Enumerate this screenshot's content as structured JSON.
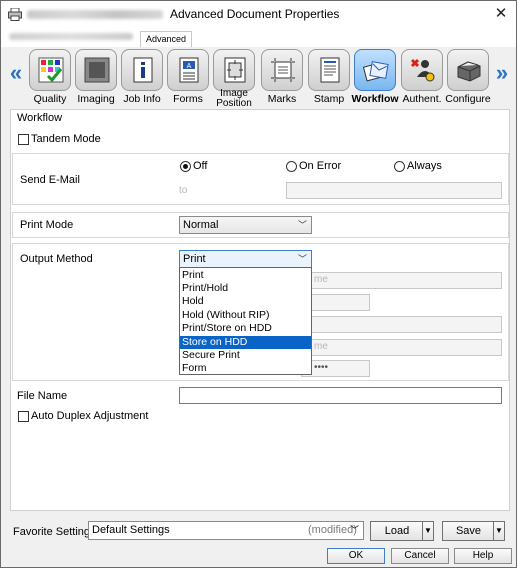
{
  "window": {
    "title": "Advanced Document Properties"
  },
  "tabs": {
    "advanced": "Advanced"
  },
  "iconbar": {
    "items": [
      {
        "label": "Quality",
        "icon": "quality-icon"
      },
      {
        "label": "Imaging",
        "icon": "imaging-icon"
      },
      {
        "label": "Job Info",
        "icon": "job-info-icon"
      },
      {
        "label": "Forms",
        "icon": "forms-icon"
      },
      {
        "label": "Image Position",
        "icon": "image-position-icon"
      },
      {
        "label": "Marks",
        "icon": "marks-icon"
      },
      {
        "label": "Stamp",
        "icon": "stamp-icon"
      },
      {
        "label": "Workflow",
        "icon": "workflow-icon",
        "active": true
      },
      {
        "label": "Authent.",
        "icon": "authent-icon"
      },
      {
        "label": "Configure",
        "icon": "configure-icon"
      }
    ],
    "left_arrow": "«",
    "right_arrow": "»"
  },
  "workflow": {
    "section_label": "Workflow",
    "tandem_mode": "Tandem Mode",
    "send_email": {
      "label": "Send E-Mail",
      "options": [
        "Off",
        "On Error",
        "Always"
      ],
      "selected": "Off",
      "to_label": "to",
      "to_value": ""
    },
    "print_mode": {
      "label": "Print Mode",
      "value": "Normal"
    },
    "output_method": {
      "label": "Output Method",
      "value": "Print",
      "options": [
        "Print",
        "Print/Hold",
        "Hold",
        "Hold (Without RIP)",
        "Print/Store on HDD",
        "Store on HDD",
        "Secure Print",
        "Form"
      ],
      "highlighted": "Store on HDD",
      "hidden_fragments": [
        "me",
        "me",
        "••••"
      ]
    },
    "file_name": {
      "label": "File Name",
      "value": ""
    },
    "auto_duplex": "Auto Duplex Adjustment"
  },
  "bottom": {
    "favorite_label": "Favorite Setting",
    "favorite_value": "Default Settings",
    "favorite_modified": "(modified)",
    "load": "Load",
    "save": "Save",
    "ok": "OK",
    "cancel": "Cancel",
    "help": "Help"
  },
  "colors": {
    "selection": "#0a64c8",
    "nav_arrow": "#2a72c4"
  }
}
